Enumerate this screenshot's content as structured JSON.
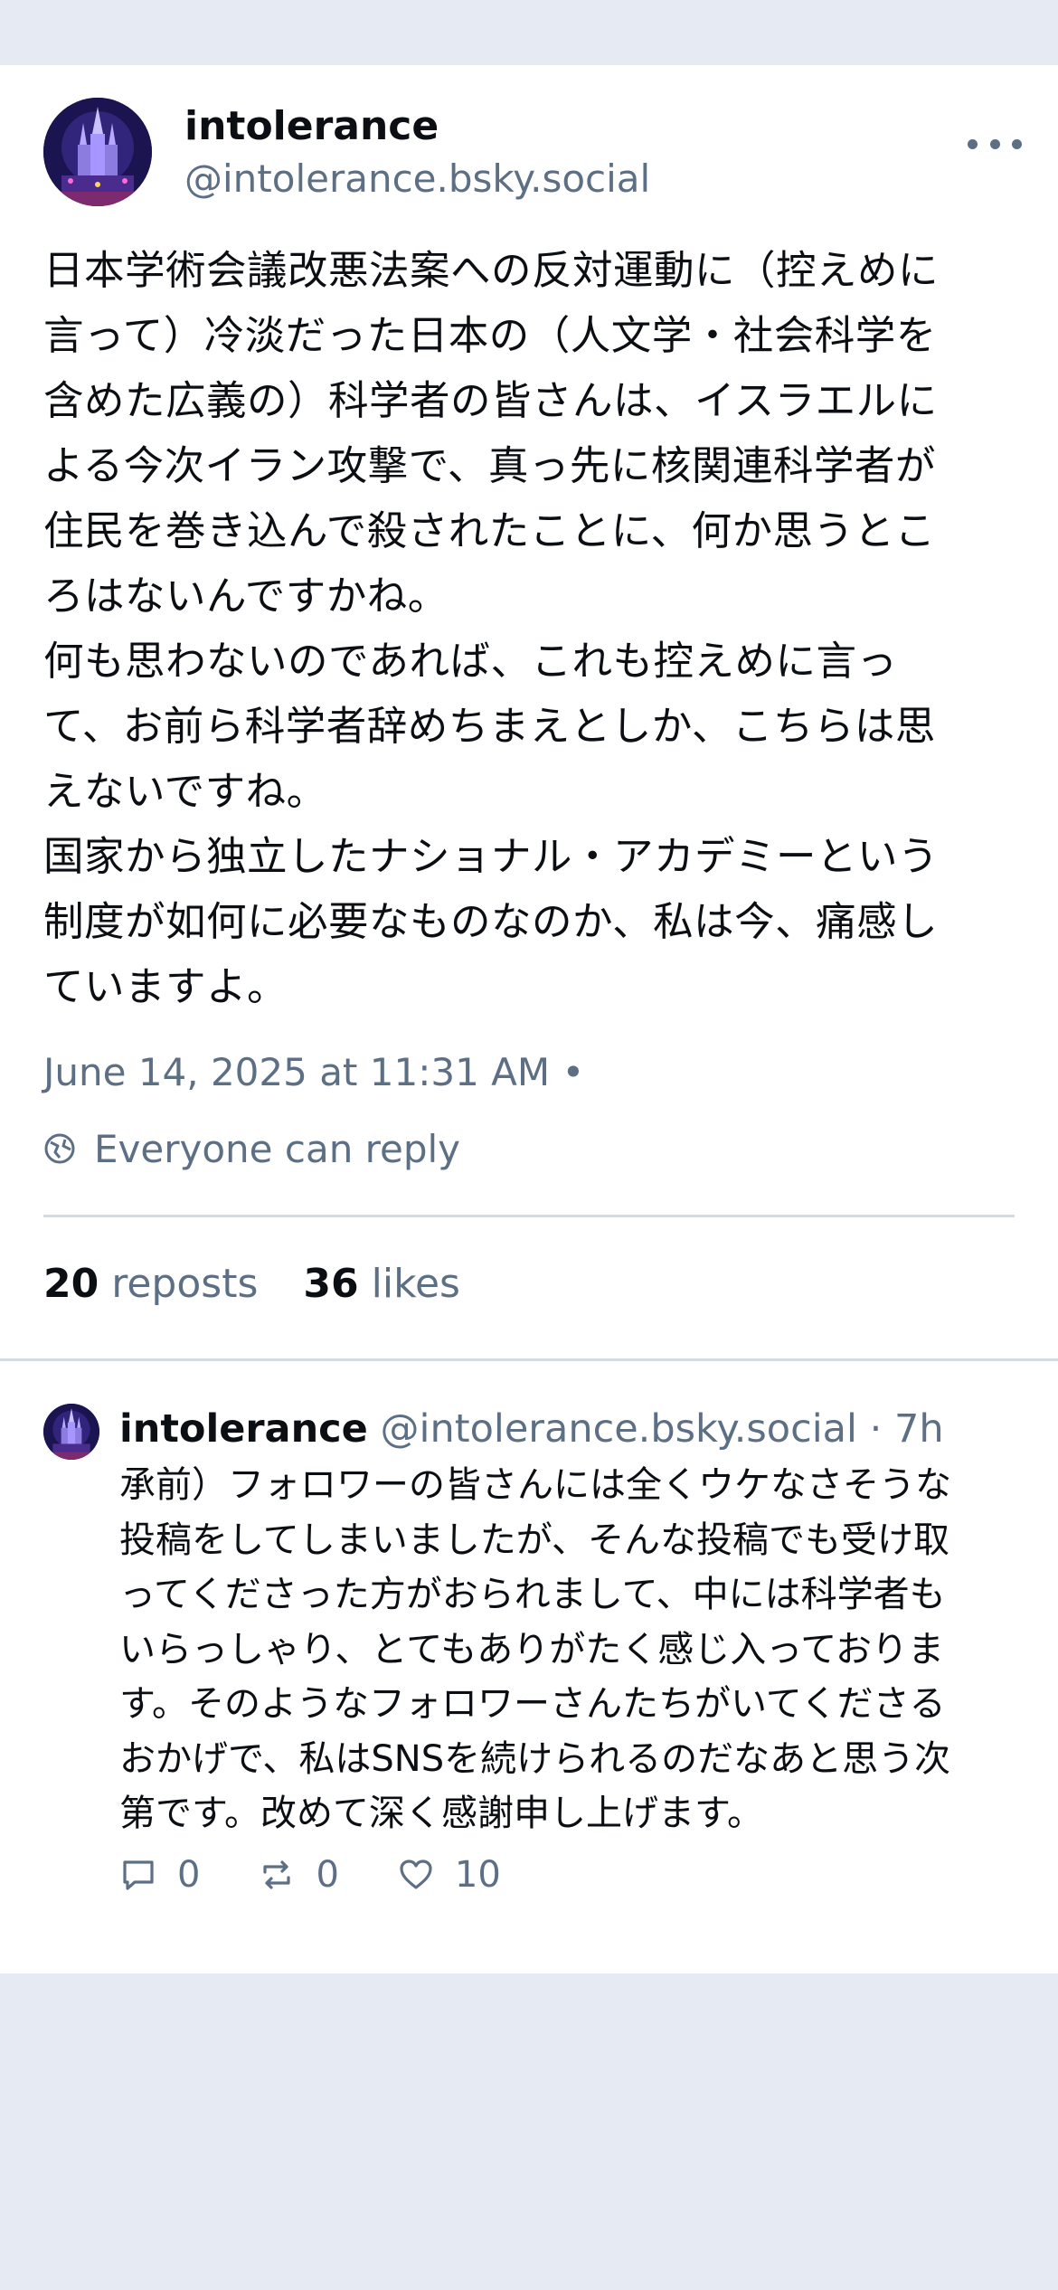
{
  "post": {
    "author_name": "intolerance",
    "author_handle": "@intolerance.bsky.social",
    "more_icon": "more-horizontal-icon",
    "text": "日本学術会議改悪法案への反対運動に（控えめに\n言って）冷淡だった日本の（人文学・社会科学を\n含めた広義の）科学者の皆さんは、イスラエルに\nよる今次イラン攻撃で、真っ先に核関連科学者が\n住民を巻き込んで殺されたことに、何か思うとこ\nろはないんですかね。\n何も思わないのであれば、これも控えめに言っ\nて、お前ら科学者辞めちまえとしか、こちらは思\nえないですね。\n国家から独立したナショナル・アカデミーという\n制度が如何に必要なものなのか、私は今、痛感し\nていますよ。",
    "timestamp": "June 14, 2025 at 11:31 AM  •",
    "reply_setting": "Everyone can reply",
    "reposts_count": "20",
    "reposts_label": "reposts",
    "likes_count": "36",
    "likes_label": "likes"
  },
  "reply": {
    "author_name": "intolerance",
    "author_handle": "@intolerance.bsky.social",
    "separator": "·",
    "time": "7h",
    "text": "承前）フォロワーの皆さんには全くウケなさそうな\n投稿をしてしまいましたが、そんな投稿でも受け取\nってくださった方がおられまして、中には科学者も\nいらっしゃり、とてもありがたく感じ入っておりま\nす。そのようなフォロワーさんたちがいてくださる\nおかげで、私はSNSを続けられるのだなあと思う次\n第です。改めて深く感謝申し上げます。",
    "replies_count": "0",
    "reposts_count": "0",
    "likes_count": "10"
  },
  "colors": {
    "background": "#e6ebf3",
    "card": "#ffffff",
    "muted_text": "#5d6f84",
    "divider": "#d4dbe3"
  }
}
